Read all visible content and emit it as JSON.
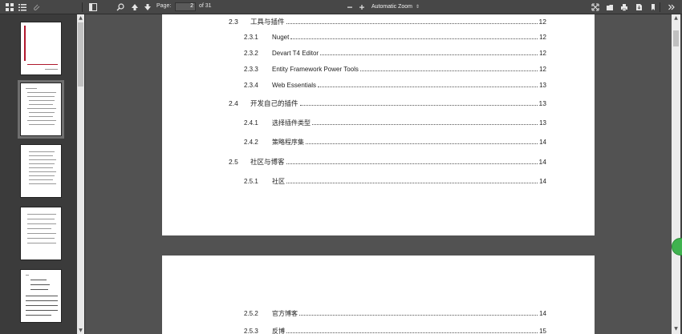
{
  "toolbar": {
    "page_label": "Page:",
    "page_value": "2",
    "page_count": "of 31",
    "zoom_value": "Automatic Zoom",
    "icons": {
      "sidebar_toggle_thumbs": "thumbnails-icon",
      "sidebar_toggle_outline": "outline-icon",
      "sidebar_toggle_attach": "attachment-icon",
      "toggle_sidebar": "toggle-sidebar-icon",
      "search": "search-icon",
      "prev": "arrow-up-icon",
      "next": "arrow-down-icon",
      "zoom_out": "minus-icon",
      "zoom_in": "plus-icon",
      "presentation": "fullscreen-icon",
      "open": "open-file-icon",
      "print": "print-icon",
      "download": "download-icon",
      "bookmark": "bookmark-icon",
      "tools": "double-chevron-icon"
    }
  },
  "toc": [
    {
      "num": "2.3",
      "title": "工具与插件",
      "page": "12",
      "level": 1
    },
    {
      "num": "2.3.1",
      "title": "Nuget",
      "page": "12",
      "level": 2
    },
    {
      "num": "2.3.2",
      "title": "Devart T4 Editor",
      "page": "12",
      "level": 2
    },
    {
      "num": "2.3.3",
      "title": "Entity Framework Power Tools",
      "page": "12",
      "level": 2
    },
    {
      "num": "2.3.4",
      "title": "Web Essentials",
      "page": "13",
      "level": 2
    },
    {
      "num": "2.4",
      "title": "开发自己的插件",
      "page": "13",
      "level": 1
    },
    {
      "num": "2.4.1",
      "title": "选择插件类型",
      "page": "13",
      "level": 2
    },
    {
      "num": "2.4.2",
      "title": "策略程序集",
      "page": "14",
      "level": 2
    },
    {
      "num": "2.5",
      "title": "社区与博客",
      "page": "14",
      "level": 1
    },
    {
      "num": "2.5.1",
      "title": "社区",
      "page": "14",
      "level": 2
    }
  ],
  "toc_next_page": [
    {
      "num": "2.5.2",
      "title": "官方博客",
      "page": "14",
      "level": 2
    },
    {
      "num": "2.5.3",
      "title": "反博",
      "page": "15",
      "level": 2
    }
  ],
  "colors": {
    "toolbar": "#474747",
    "sidebar": "#3b3b3b",
    "viewer_bg": "#525252",
    "page": "#ffffff",
    "green": "#3fb24f"
  }
}
